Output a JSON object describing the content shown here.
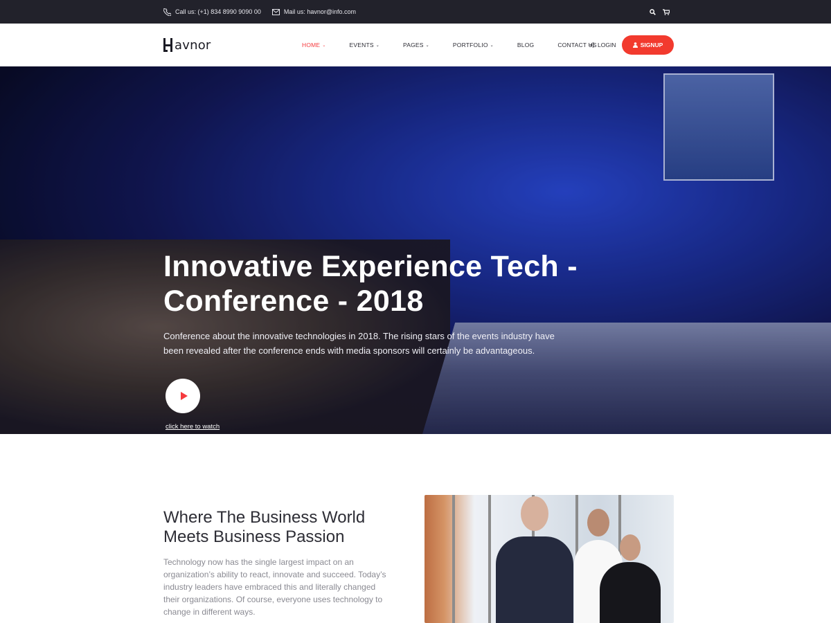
{
  "topbar": {
    "phone": "Call us: (+1) 834 8990 9090 00",
    "email": "Mail us: havnor@info.com",
    "icons": [
      "phone-icon",
      "mail-icon",
      "search-icon",
      "cart-icon"
    ]
  },
  "navbar": {
    "logo": "avnor",
    "menu": [
      "HOME",
      "EVENTS",
      "PAGES",
      "PORTFOLIO",
      "BLOG",
      "CONTACT US"
    ],
    "login": "LOGIN",
    "signup": "SIGNUP"
  },
  "hero": {
    "title": "Innovative Experience Tech - Conference - 2018",
    "description": "Conference about the innovative technologies in 2018. The rising stars of the events industry have been revealed after the conference ends with media sponsors will certainly be advantageous.",
    "watch": "click here to watch"
  },
  "about": {
    "title": "Where The Business World Meets Business Passion",
    "text": "Technology now has the single largest impact on an organization’s ability to react, innovate and succeed. Today’s industry leaders have embraced this and literally changed their organizations. Of course, everyone uses technology to change in different ways."
  },
  "colors": {
    "accent": "#f23a2e",
    "topbar": "#22222b"
  }
}
